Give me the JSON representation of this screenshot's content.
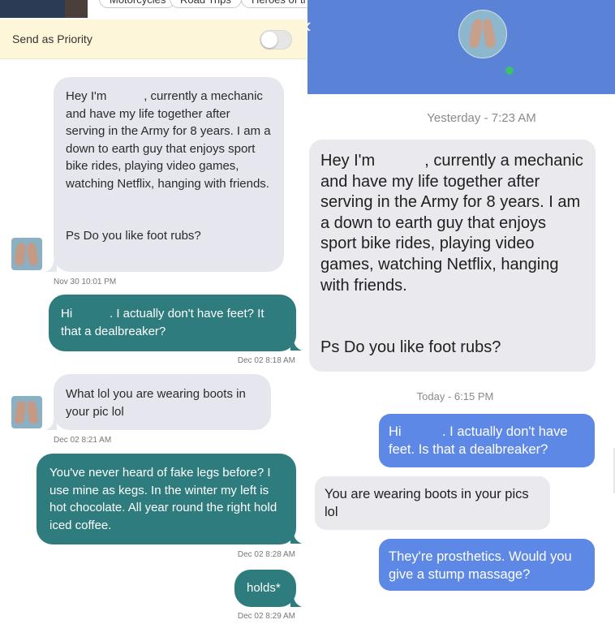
{
  "left": {
    "chips": [
      "Motorcycles",
      "Road Trips",
      "Heroes of th"
    ],
    "priority": {
      "label": "Send as Priority",
      "enabled": false
    },
    "messages": [
      {
        "direction": "in",
        "paragraph1": "Hey I'm           , currently a mechanic and have my life together after serving in the Army for 8 years. I am a down to earth guy that enjoys sport bike rides, playing video games, watching Netflix, hanging with friends.",
        "paragraph2": "Ps Do you like foot rubs?",
        "time": "Nov 30 10:01 PM"
      },
      {
        "direction": "out",
        "text": "Hi           . I actually don't have feet? It that a dealbreaker?",
        "time": "Dec 02 8:18 AM"
      },
      {
        "direction": "in",
        "text": "What lol you are wearing boots in your pic lol",
        "time": "Dec 02 8:21 AM"
      },
      {
        "direction": "out",
        "text": "You've never heard of fake legs before? I use mine as kegs. In the winter my left is hot chocolate. All year round the right hold iced coffee.",
        "time": "Dec 02 8:28 AM"
      },
      {
        "direction": "out",
        "text": "holds*",
        "time": "Dec 02 8:29 AM"
      }
    ]
  },
  "right": {
    "header_color": "#5a82d6",
    "online": true,
    "day1": "Yesterday - 7:23 AM",
    "day2": "Today - 6:15 PM",
    "messages": [
      {
        "direction": "in",
        "paragraph1": "Hey I'm           , currently a mechanic and have my life together after serving in the Army for 8 years. I am a down to earth guy that enjoys sport bike rides, playing video games, watching Netflix, hanging with friends.",
        "paragraph2": "Ps Do you like foot rubs?"
      },
      {
        "direction": "out",
        "text": "Hi           . I actually don't have feet. Is that a dealbreaker?"
      },
      {
        "direction": "in",
        "text": "You are wearing boots in your pics lol"
      },
      {
        "direction": "out",
        "text": "They're prosthetics. Would you give a stump massage?"
      }
    ]
  },
  "colors": {
    "outgoing_left": "#2f7c7e",
    "outgoing_right": "#5d88e5",
    "incoming": "#e6e7ee",
    "priority_bg": "#fdf6d8"
  }
}
